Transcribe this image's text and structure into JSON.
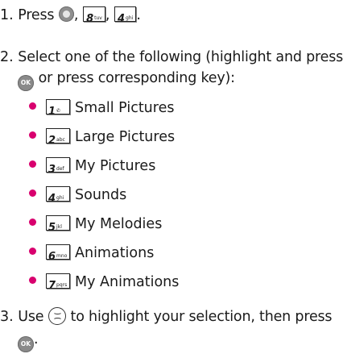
{
  "step1": {
    "number": "1.",
    "text": "Press",
    "sep1": ",",
    "sep2": ",",
    "end": ".",
    "key8": {
      "num": "8",
      "sub": "tuv"
    },
    "key4": {
      "num": "4",
      "sub": "ghi"
    }
  },
  "step2": {
    "number": "2.",
    "line1": "Select one of the following (highlight and press",
    "line2_ok": "OK",
    "line2": "or press corresponding key):"
  },
  "items": [
    {
      "key": "1",
      "sub": "✆",
      "label": "Small Pictures"
    },
    {
      "key": "2",
      "sub": "abc",
      "label": "Large Pictures"
    },
    {
      "key": "3",
      "sub": "def",
      "label": "My Pictures"
    },
    {
      "key": "4",
      "sub": "ghi",
      "label": "Sounds"
    },
    {
      "key": "5",
      "sub": "jkl",
      "label": "My Melodies"
    },
    {
      "key": "6",
      "sub": "mno",
      "label": "Animations"
    },
    {
      "key": "7",
      "sub": "pqrs",
      "label": "My Animations"
    }
  ],
  "step3": {
    "number": "3.",
    "text_a": "Use",
    "text_b": "to highlight your selection, then press",
    "ok": "OK",
    "end": "."
  },
  "colors": {
    "bullet": "#d8006e",
    "text": "#1a1a1a"
  }
}
